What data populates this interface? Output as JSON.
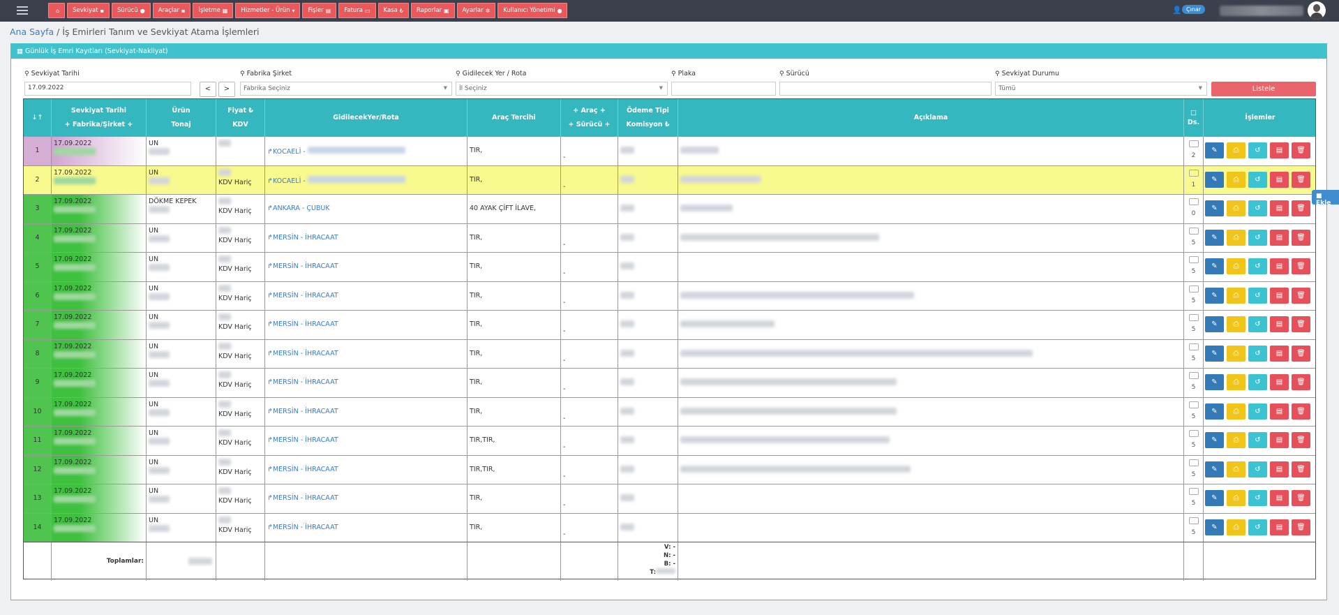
{
  "nav": {
    "items": [
      {
        "label": "",
        "icon": "home-icon"
      },
      {
        "label": "Sevkiyat",
        "icon": "truck-icon"
      },
      {
        "label": "Sürücü",
        "icon": "user-icon"
      },
      {
        "label": "Araçlar",
        "icon": "car-icon"
      },
      {
        "label": "İşletme",
        "icon": "building-icon"
      },
      {
        "label": "Hizmetler - Ürün",
        "icon": "cart-icon"
      },
      {
        "label": "Fişler",
        "icon": "file-icon"
      },
      {
        "label": "Fatura",
        "icon": "invoice-icon"
      },
      {
        "label": "Kasa",
        "icon": "lira-icon"
      },
      {
        "label": "Raporlar",
        "icon": "report-icon"
      },
      {
        "label": "Ayarlar",
        "icon": "cogs-icon"
      },
      {
        "label": "Kullanıcı Yönetimi",
        "icon": "user-icon"
      }
    ],
    "user_badge": "Çınar"
  },
  "breadcrumb": {
    "home": "Ana Sayfa",
    "separator": " / ",
    "current": "İş Emirleri Tanım ve Sevkiyat Atama İşlemleri"
  },
  "panel": {
    "title": "Günlük İş Emri Kayıtları (Sevkiyat-Nakliyat)"
  },
  "filters": {
    "date_label": "Sevkiyat Tarihi",
    "date_value": "17.09.2022",
    "prev": "<",
    "next": ">",
    "company_label": "Fabrika Şirket",
    "company_value": "Fabrika Seçiniz",
    "route_label": "Gidilecek Yer / Rota",
    "route_value": "İl Seçiniz",
    "plate_label": "Plaka",
    "driver_label": "Sürücü",
    "status_label": "Sevkiyat Durumu",
    "status_value": "Tümü",
    "list_button": "Listele"
  },
  "table": {
    "headers": {
      "sort": "↓↑",
      "date1": "Sevkiyat Tarihi",
      "date2": "+ Fabrika/Şirket +",
      "product1": "Ürün",
      "product2": "Tonaj",
      "price1": "Fiyat ₺",
      "price2": "KDV",
      "route": "GidilecekYer/Rota",
      "vehicle": "Araç Tercihi",
      "assign1": "+ Araç +",
      "assign2": "+ Sürücü +",
      "pay1": "Ödeme Tipi",
      "pay2": "Komisyon ₺",
      "desc": "Açıklama",
      "ds": "Ds.",
      "actions": "İşlemler"
    },
    "rows": [
      {
        "no": "1",
        "date": "17.09.2022",
        "product": "UN",
        "kdv": "",
        "route": "KOCAELİ - ",
        "vehicle": "TIR,",
        "assign": "-",
        "msgs": "2",
        "bg": "#d9b6d9",
        "blur": [
          55,
          0
        ]
      },
      {
        "no": "2",
        "date": "17.09.2022",
        "product": "UN",
        "kdv": "KDV Hariç",
        "route": "KOCAELİ - ",
        "vehicle": "TIR,",
        "assign": "-",
        "msgs": "1",
        "bg": "#f6f78a",
        "blur": [
          115,
          0
        ]
      },
      {
        "no": "3",
        "date": "17.09.2022",
        "product": "DÖKME KEPEK",
        "kdv": "KDV Hariç",
        "route": "ANKARA - ÇUBUK",
        "vehicle": "40 AYAK ÇİFT İLAVE,",
        "assign": "",
        "msgs": "0",
        "bg": "#4cc24c",
        "blur": [
          75,
          0
        ]
      },
      {
        "no": "4",
        "date": "17.09.2022",
        "product": "UN",
        "kdv": "KDV Hariç",
        "route": "MERSİN - İHRACAAT",
        "vehicle": "TIR,",
        "assign": "-",
        "msgs": "5",
        "bg": "#4cc24c",
        "blur": [
          285,
          0
        ]
      },
      {
        "no": "5",
        "date": "17.09.2022",
        "product": "UN",
        "kdv": "KDV Hariç",
        "route": "MERSİN - İHRACAAT",
        "vehicle": "TIR,",
        "assign": "-",
        "msgs": "5",
        "bg": "#4cc24c",
        "blur": [
          0,
          0
        ]
      },
      {
        "no": "6",
        "date": "17.09.2022",
        "product": "UN",
        "kdv": "KDV Hariç",
        "route": "MERSİN - İHRACAAT",
        "vehicle": "TIR,",
        "assign": "-",
        "msgs": "5",
        "bg": "#4cc24c",
        "blur": [
          335,
          0
        ]
      },
      {
        "no": "7",
        "date": "17.09.2022",
        "product": "UN",
        "kdv": "KDV Hariç",
        "route": "MERSİN - İHRACAAT",
        "vehicle": "TIR,",
        "assign": "-",
        "msgs": "5",
        "bg": "#4cc24c",
        "blur": [
          135,
          0
        ]
      },
      {
        "no": "8",
        "date": "17.09.2022",
        "product": "UN",
        "kdv": "KDV Hariç",
        "route": "MERSİN - İHRACAAT",
        "vehicle": "TIR,",
        "assign": "-",
        "msgs": "5",
        "bg": "#4cc24c",
        "blur": [
          505,
          0
        ]
      },
      {
        "no": "9",
        "date": "17.09.2022",
        "product": "UN",
        "kdv": "KDV Hariç",
        "route": "MERSİN - İHRACAAT",
        "vehicle": "TIR,",
        "assign": "-",
        "msgs": "5",
        "bg": "#4cc24c",
        "blur": [
          310,
          0
        ]
      },
      {
        "no": "10",
        "date": "17.09.2022",
        "product": "UN",
        "kdv": "KDV Hariç",
        "route": "MERSİN - İHRACAAT",
        "vehicle": "TIR,",
        "assign": "-",
        "msgs": "5",
        "bg": "#4cc24c",
        "blur": [
          310,
          0
        ]
      },
      {
        "no": "11",
        "date": "17.09.2022",
        "product": "UN",
        "kdv": "KDV Hariç",
        "route": "MERSİN - İHRACAAT",
        "vehicle": "TIR,TIR,",
        "assign": "-",
        "msgs": "5",
        "bg": "#4cc24c",
        "blur": [
          300,
          0
        ]
      },
      {
        "no": "12",
        "date": "17.09.2022",
        "product": "UN",
        "kdv": "KDV Hariç",
        "route": "MERSİN - İHRACAAT",
        "vehicle": "TIR,TIR,",
        "assign": "-",
        "msgs": "5",
        "bg": "#4cc24c",
        "blur": [
          330,
          0
        ]
      },
      {
        "no": "13",
        "date": "17.09.2022",
        "product": "UN",
        "kdv": "KDV Hariç",
        "route": "MERSİN - İHRACAAT",
        "vehicle": "TIR,",
        "assign": "-",
        "msgs": "5",
        "bg": "#4cc24c",
        "blur": [
          0,
          0
        ]
      },
      {
        "no": "14",
        "date": "17.09.2022",
        "product": "UN",
        "kdv": "KDV Hariç",
        "route": "MERSİN - İHRACAAT",
        "vehicle": "TIR,",
        "assign": "-",
        "msgs": "5",
        "bg": "#4cc24c",
        "blur": [
          0,
          0
        ]
      }
    ],
    "totals": {
      "label": "Toplamlar:",
      "v": "V: -",
      "n": "N: -",
      "b": "B: -",
      "t": "T:"
    }
  },
  "side_button": "Ekle",
  "colors": {
    "nav_button": "#e9585a",
    "header": "#34b7be",
    "listele": "#e9646b"
  }
}
